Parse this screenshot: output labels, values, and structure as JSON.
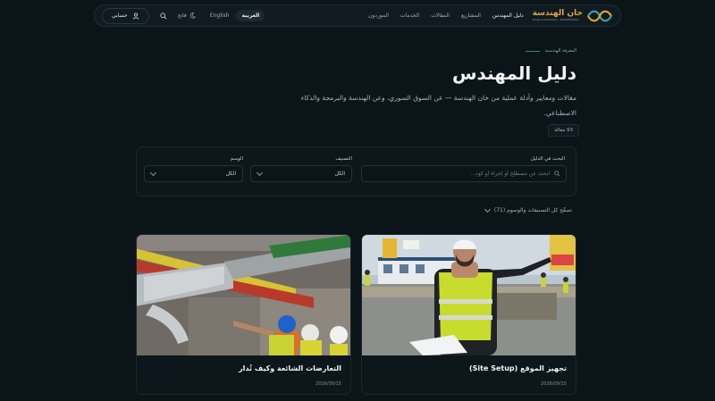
{
  "nav": {
    "logo_title": "خان الهندسة",
    "logo_subtitle": "KHAN ALHANDASA · ENGINEERING",
    "links": [
      "دليل المهندس",
      "المشاريع",
      "المقالات",
      "الخدمات",
      "الموردون"
    ],
    "lang_ar": "العربية",
    "lang_en": "English",
    "theme_label": "فاتح",
    "account_label": "حسابي"
  },
  "hero": {
    "breadcrumb": "المعرفة الهندسية",
    "title": "دليل المهندس",
    "description": "مقالات ومعايير وأدلة عملية من خان الهندسة — عن السوق السوري، وعن الهندسة والبرمجة والذكاء الاصطناعي.",
    "count": "93 مقالة"
  },
  "filters": {
    "search_label": "البحث في الدليل",
    "search_placeholder": "ابحث عن مصطلح أو إجراء أو كود...",
    "category_label": "التصنيف",
    "category_value": "الكل",
    "tag_label": "الوسم",
    "tag_value": "الكل",
    "browse_all": "تصفّح كل التصنيفات والوسوم (71)"
  },
  "cards": [
    {
      "title": "تجهيز الموقع (Site Setup)",
      "date": "2026/09/15"
    },
    {
      "title": "التعارضات الشائعة وكيف تُدار",
      "date": "2026/09/15"
    }
  ],
  "colors": {
    "accent": "#d9a441",
    "background": "#0b1418",
    "teal": "#3d7f82"
  }
}
